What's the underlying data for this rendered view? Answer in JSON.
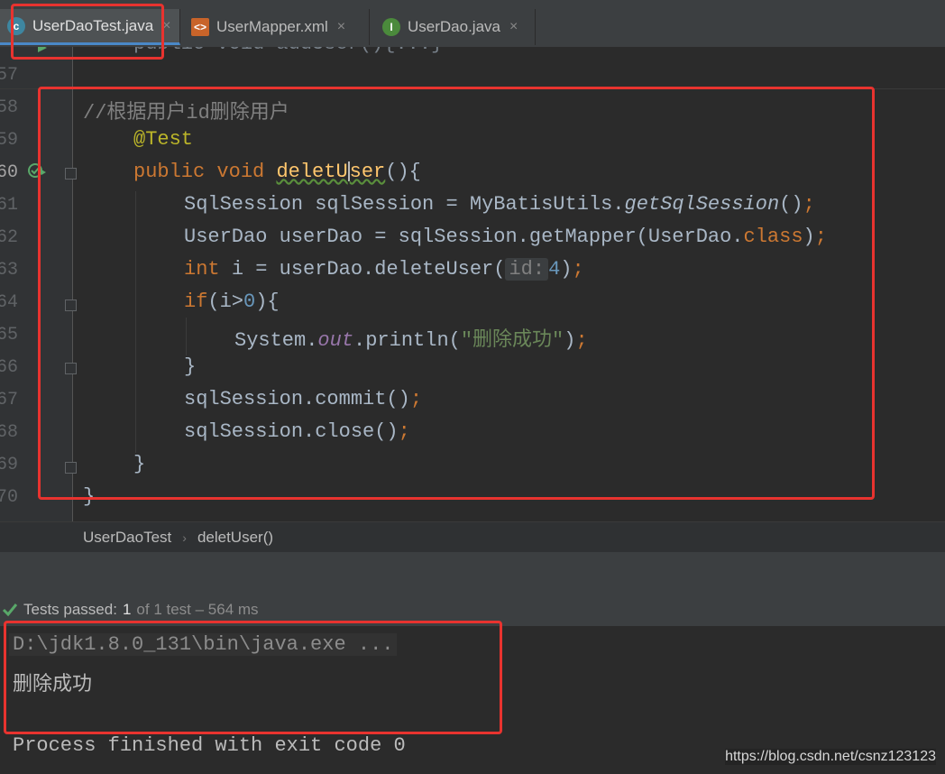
{
  "tabs": [
    {
      "label": "UserDaoTest.java",
      "icon": "java-test-class-icon",
      "active": true
    },
    {
      "label": "UserMapper.xml",
      "icon": "xml-file-icon",
      "active": false
    },
    {
      "label": "UserDao.java",
      "icon": "interface-icon",
      "active": false
    }
  ],
  "tab_close_glyph": "×",
  "editor": {
    "line_numbers": [
      "57",
      "58",
      "59",
      "60",
      "61",
      "62",
      "63",
      "64",
      "65",
      "66",
      "67",
      "68",
      "69",
      "70"
    ],
    "partial_top_line": "public void addUser(){...}",
    "comment": "//根据用户id删除用户",
    "annotation": "@Test",
    "method_sig": {
      "kw1": "public",
      "kw2": "void",
      "name_a": "deletU",
      "name_b": "ser",
      "rest": "(){"
    },
    "line61": {
      "type": "SqlSession",
      "var": "sqlSession",
      "eq": "=",
      "cls": "MyBatisUtils.",
      "method": "getSqlSession",
      "tail": "()",
      "semi": ";"
    },
    "line62": {
      "pre": "UserDao userDao = sqlSession.getMapper(UserDao.",
      "kw": "class",
      "tail": ")",
      "semi": ";"
    },
    "line63": {
      "kw": "int",
      "mid": "i = userDao.deleteUser(",
      "hint": "id:",
      "num": "4",
      "tail": ")",
      "semi": ";"
    },
    "line64": {
      "kw": "if",
      "pre": "(i>",
      "num": "0",
      "tail": "){"
    },
    "line65": {
      "pre": "System.",
      "field": "out",
      "mid": ".println(",
      "str": "\"删除成功\"",
      "tail": ")",
      "semi": ";"
    },
    "line66": "}",
    "line67": {
      "code": "sqlSession.commit()",
      "semi": ";"
    },
    "line68": {
      "code": "sqlSession.close()",
      "semi": ";"
    },
    "line69": "}",
    "line70": "}"
  },
  "breadcrumb": {
    "class": "UserDaoTest",
    "separator": "›",
    "method": "deletUser()"
  },
  "test_status": {
    "label": "Tests passed:",
    "passed": "1",
    "rest": "of 1 test – 564 ms"
  },
  "console": {
    "cmd": "D:\\jdk1.8.0_131\\bin\\java.exe ...",
    "output": "删除成功",
    "exit": "Process finished with exit code 0"
  },
  "watermark": "https://blog.csdn.net/csnz123123",
  "colors": {
    "highlight": "#e8332f",
    "keyword": "#cc7832",
    "string": "#6a8759",
    "method": "#ffc66d"
  }
}
